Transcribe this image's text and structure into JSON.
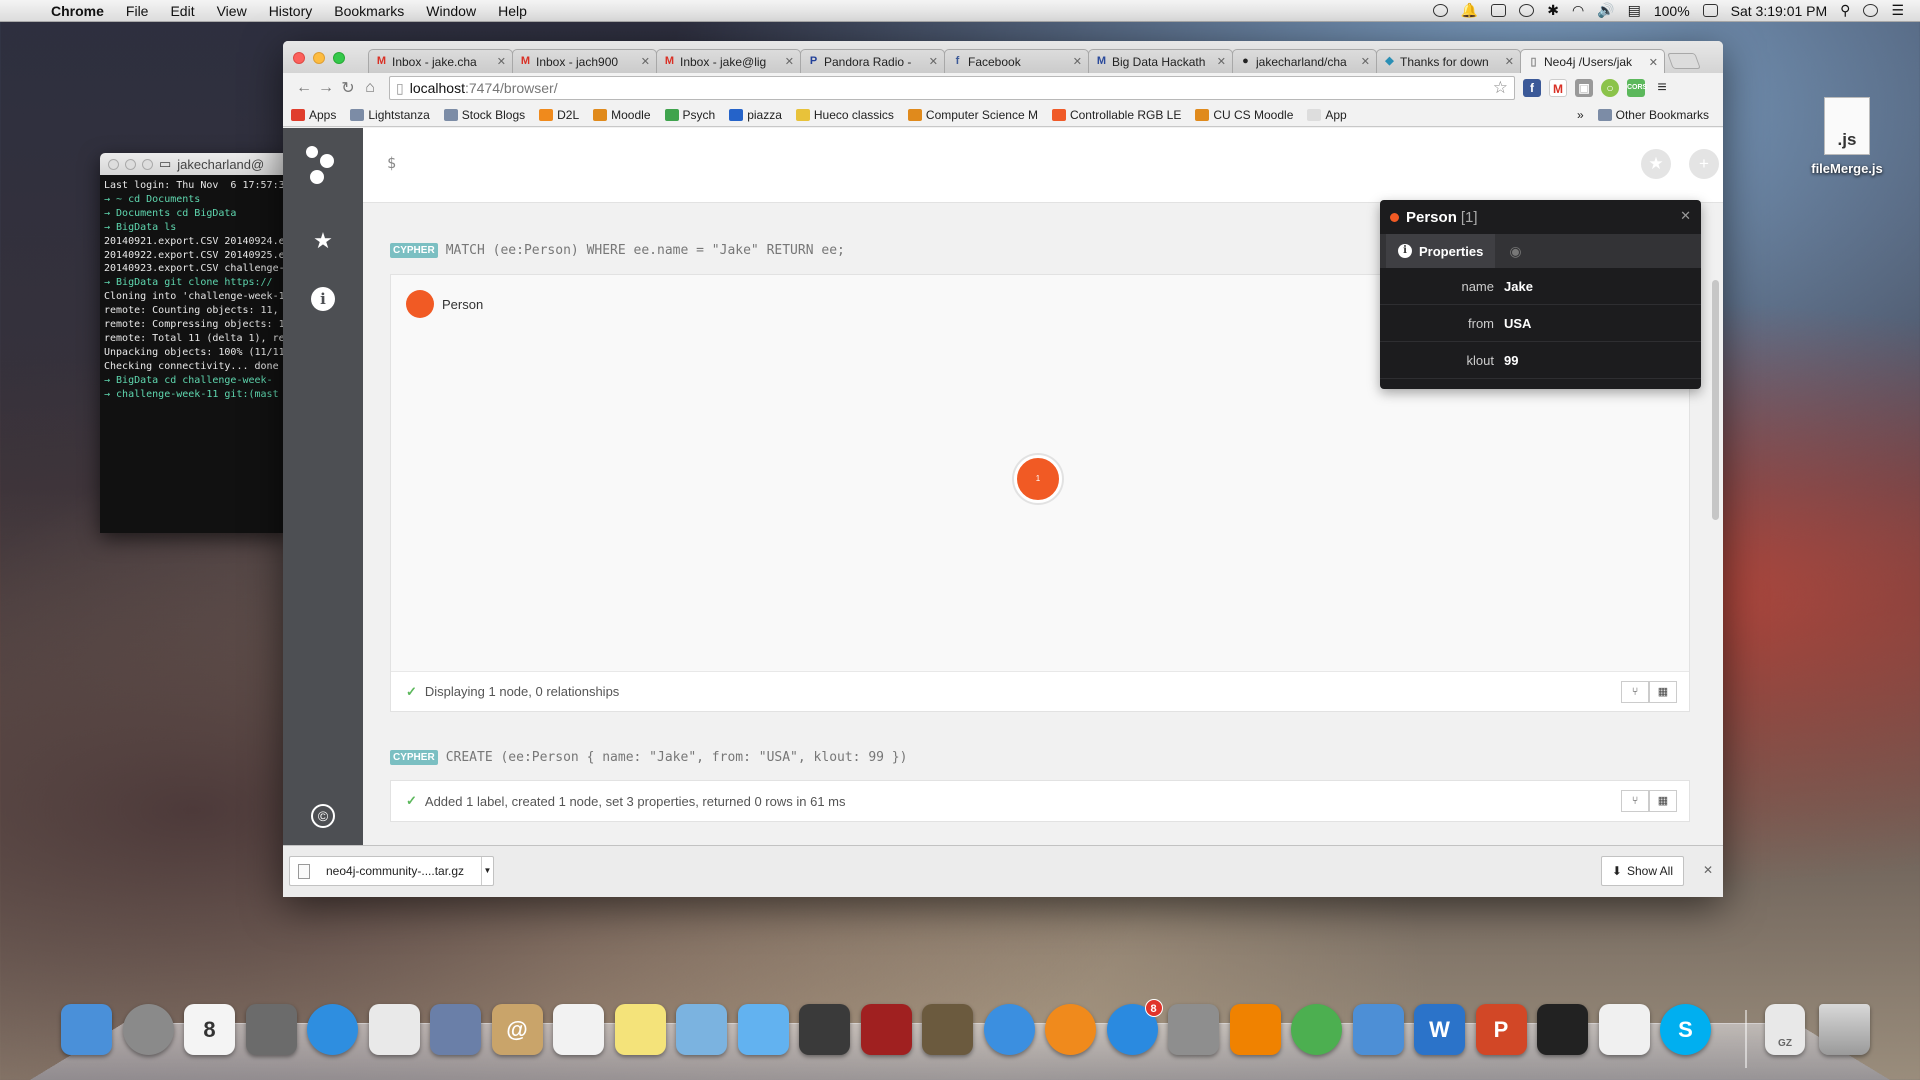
{
  "menubar": {
    "app": "Chrome",
    "items": [
      "File",
      "Edit",
      "View",
      "History",
      "Bookmarks",
      "Window",
      "Help"
    ],
    "battery": "100%",
    "clock": "Sat 3:19:01 PM"
  },
  "terminal": {
    "title": "jakecharland@",
    "lines": [
      "Last login: Thu Nov  6 17:57:3",
      "→ ~ cd Documents",
      "→ Documents cd BigData",
      "→ BigData ls",
      "20140921.export.CSV 20140924.e",
      "20140922.export.CSV 20140925.e",
      "20140923.export.CSV challenge-",
      "→ BigData git clone https://",
      "Cloning into 'challenge-week-1",
      "remote: Counting objects: 11,",
      "remote: Compressing objects: 1",
      "remote: Total 11 (delta 1), re",
      "Unpacking objects: 100% (11/11",
      "Checking connectivity... done",
      "→ BigData cd challenge-week-",
      "→ challenge-week-11 git:(mast"
    ]
  },
  "chrome": {
    "tabs": [
      {
        "label": "Inbox - jake.cha",
        "icon": "gmail-icon",
        "fav": "M",
        "color": "#d93025"
      },
      {
        "label": "Inbox - jach900",
        "icon": "gmail-icon",
        "fav": "M",
        "color": "#d93025"
      },
      {
        "label": "Inbox - jake@lig",
        "icon": "gmail-icon",
        "fav": "M",
        "color": "#d93025"
      },
      {
        "label": "Pandora Radio -",
        "icon": "pandora-icon",
        "fav": "P",
        "color": "#224099"
      },
      {
        "label": "Facebook",
        "icon": "facebook-icon",
        "fav": "f",
        "color": "#3b5998"
      },
      {
        "label": "Big Data Hackath",
        "icon": "meetup-icon",
        "fav": "M",
        "color": "#2b4a9b"
      },
      {
        "label": "jakecharland/cha",
        "icon": "github-icon",
        "fav": "●",
        "color": "#222222"
      },
      {
        "label": "Thanks for down",
        "icon": "neo-download-icon",
        "fav": "◆",
        "color": "#2a8fb5"
      },
      {
        "label": "Neo4j /Users/jak",
        "icon": "page-icon",
        "fav": "▯",
        "color": "#888888"
      }
    ],
    "url_host": "localhost",
    "url_path": ":7474/browser/",
    "bookmarks": [
      {
        "label": "Apps",
        "icon": "apps-grid-icon"
      },
      {
        "label": "Lightstanza",
        "icon": "folder-icon"
      },
      {
        "label": "Stock Blogs",
        "icon": "folder-icon"
      },
      {
        "label": "D2L",
        "icon": "d2l-icon"
      },
      {
        "label": "Moodle",
        "icon": "moodle-icon"
      },
      {
        "label": "Psych",
        "icon": "psych-icon"
      },
      {
        "label": "piazza",
        "icon": "piazza-icon"
      },
      {
        "label": "Hueco classics",
        "icon": "hueco-icon"
      },
      {
        "label": "Computer Science M",
        "icon": "moodle-icon"
      },
      {
        "label": "Controllable RGB LE",
        "icon": "rgb-icon"
      },
      {
        "label": "CU CS Moodle",
        "icon": "moodle-icon"
      },
      {
        "label": "App",
        "icon": "page-icon"
      }
    ],
    "other_bookmarks": "Other Bookmarks"
  },
  "neo4j": {
    "prompt": "$",
    "frame1": {
      "badge": "CYPHER",
      "query": "MATCH (ee:Person) WHERE ee.name = \"Jake\" RETURN ee;",
      "legend_label": "Person",
      "node_label": "1",
      "status": "Displaying 1 node, 0 relationships"
    },
    "frame2": {
      "badge": "CYPHER",
      "query": "CREATE (ee:Person { name: \"Jake\", from: \"USA\", klout: 99 })",
      "status": "Added 1 label, created 1 node, set 3 properties, returned 0 rows in 61 ms"
    },
    "inspector": {
      "title": "Person",
      "count": "[1]",
      "tab_label": "Properties",
      "properties": [
        {
          "key": "name",
          "value": "Jake"
        },
        {
          "key": "from",
          "value": "USA"
        },
        {
          "key": "klout",
          "value": "99"
        }
      ]
    },
    "accent": "#f15a24"
  },
  "downloads": {
    "file": "neo4j-community-....tar.gz",
    "show_all": "Show All"
  },
  "desktop": {
    "file_ext": ".js",
    "file_name": "fileMerge.js"
  },
  "dock": {
    "apps": [
      {
        "icon": "finder-icon",
        "color": "#4a90d9"
      },
      {
        "icon": "launchpad-icon",
        "color": "#8a8a8a"
      },
      {
        "icon": "calendar-icon",
        "color": "#f4f4f4",
        "text": "8"
      },
      {
        "icon": "image-capture-icon",
        "color": "#6b6b6b"
      },
      {
        "icon": "safari-icon",
        "color": "#2e8ee0"
      },
      {
        "icon": "photo-booth-grid-icon",
        "color": "#e9e9e9"
      },
      {
        "icon": "mail-stamp-icon",
        "color": "#6a7fa8"
      },
      {
        "icon": "contacts-icon",
        "color": "#c9a46a",
        "text": "@"
      },
      {
        "icon": "reminders-icon",
        "color": "#f2f2f2"
      },
      {
        "icon": "notes-icon",
        "color": "#f4e37a"
      },
      {
        "icon": "maps-icon",
        "color": "#7bb3e0"
      },
      {
        "icon": "messages-icon",
        "color": "#62b2f0"
      },
      {
        "icon": "facetime-icon",
        "color": "#3a3a3a"
      },
      {
        "icon": "photo-booth-icon",
        "color": "#a02020"
      },
      {
        "icon": "iphoto-icon",
        "color": "#6b5a3e"
      },
      {
        "icon": "itunes-icon",
        "color": "#3b8fe0"
      },
      {
        "icon": "ibooks-icon",
        "color": "#f08a1c"
      },
      {
        "icon": "app-store-icon",
        "color": "#2a8ae0",
        "badge": "8"
      },
      {
        "icon": "system-preferences-icon",
        "color": "#8e8e8e"
      },
      {
        "icon": "vlc-icon",
        "color": "#f08200"
      },
      {
        "icon": "chrome-icon",
        "color": "#4caf50"
      },
      {
        "icon": "xcode-icon",
        "color": "#4d8fd6"
      },
      {
        "icon": "word-icon",
        "color": "#2b73c9",
        "text": "W"
      },
      {
        "icon": "powerpoint-icon",
        "color": "#d24726",
        "text": "P"
      },
      {
        "icon": "terminal-icon",
        "color": "#222222"
      },
      {
        "icon": "textedit-icon",
        "color": "#f0f0f0"
      },
      {
        "icon": "skype-icon",
        "color": "#00aff0",
        "text": "S"
      }
    ]
  }
}
